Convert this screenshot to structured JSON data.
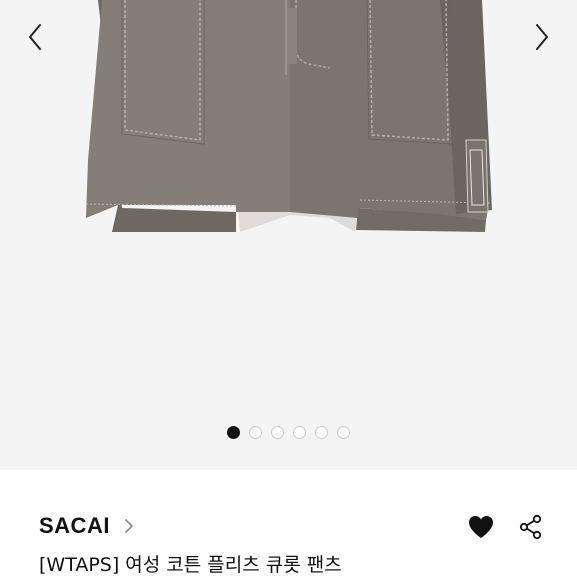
{
  "gallery": {
    "prev_icon": "chevron-left-icon",
    "next_icon": "chevron-right-icon",
    "slide_count": 6,
    "active_index": 0
  },
  "product": {
    "brand": "SACAI",
    "title": "[WTAPS] 여성 코튼 플리츠 큐롯 팬츠"
  },
  "actions": {
    "like_icon": "heart-icon",
    "share_icon": "share-icon"
  }
}
